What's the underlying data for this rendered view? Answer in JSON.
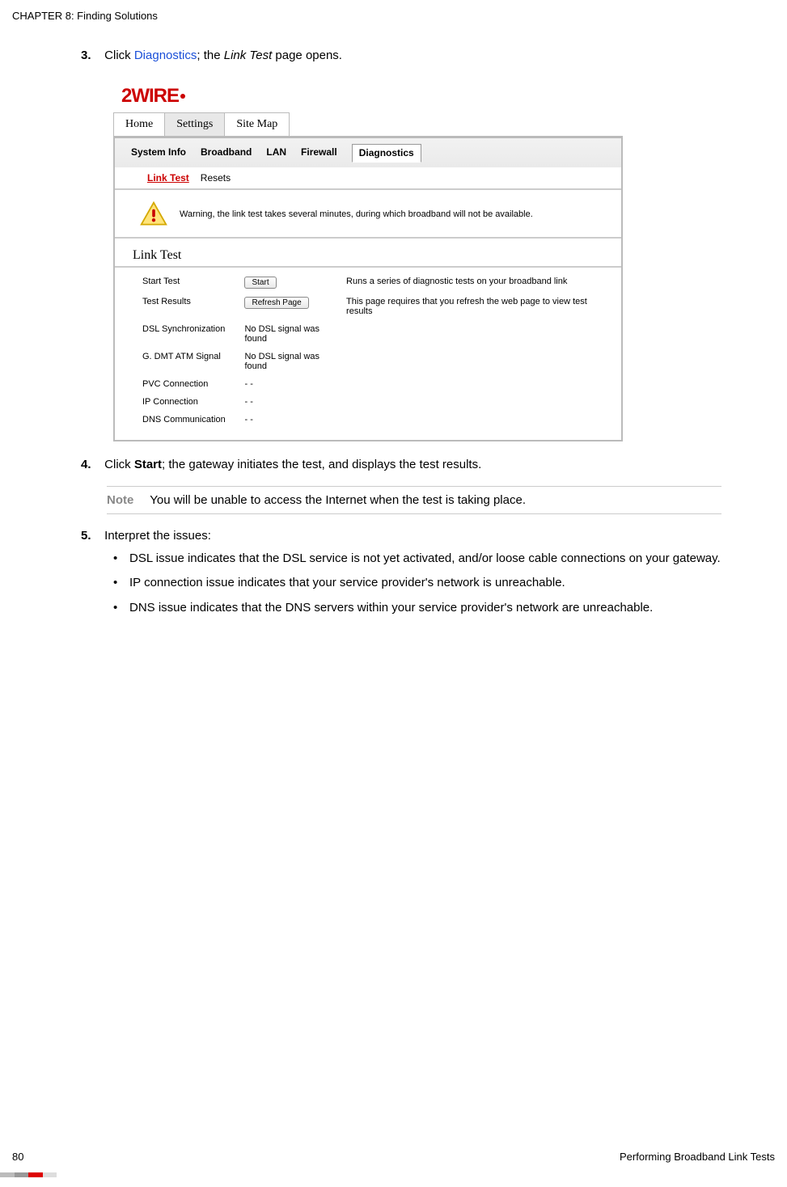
{
  "header": {
    "chapter": "CHAPTER 8: Finding Solutions"
  },
  "steps": {
    "s3": {
      "num": "3.",
      "pre": "Click ",
      "link": "Diagnostics",
      "post_a": "; the ",
      "italic": "Link Test",
      "post_b": " page opens."
    },
    "s4": {
      "num": "4.",
      "pre": "Click ",
      "bold": "Start",
      "post": "; the gateway initiates the test, and displays the test results."
    },
    "s5": {
      "num": "5.",
      "text": "Interpret the issues:",
      "bullets": [
        "DSL issue indicates that the DSL service is not yet activated, and/or loose cable connections on your gateway.",
        "IP connection issue indicates that your service provider's network is unreachable.",
        "DNS issue indicates that the DNS servers within your service provider's network are unreachable."
      ]
    }
  },
  "note": {
    "label": "Note",
    "text": "You will be unable to access the Internet when the test is taking place."
  },
  "shot": {
    "logo": "2WIRE",
    "tabs_top": {
      "home": "Home",
      "settings": "Settings",
      "sitemap": "Site Map"
    },
    "tabs_inner": {
      "sysinfo": "System Info",
      "broadband": "Broadband",
      "lan": "LAN",
      "firewall": "Firewall",
      "diag": "Diagnostics"
    },
    "subtabs": {
      "linktest": "Link Test",
      "resets": "Resets"
    },
    "warning": "Warning, the link test takes several minutes, during which broadband will not be available.",
    "section": "Link Test",
    "rows": {
      "r1": {
        "label": "Start Test",
        "btn": "Start",
        "desc": "Runs a series of diagnostic tests on your broadband link"
      },
      "r2": {
        "label": "Test Results",
        "btn": "Refresh Page",
        "desc": "This page requires that you refresh the web page to view test results"
      },
      "r3": {
        "label": "DSL Synchronization",
        "val": "No DSL signal was found"
      },
      "r4": {
        "label": "G. DMT ATM Signal",
        "val": "No DSL signal was found"
      },
      "r5": {
        "label": "PVC Connection",
        "val": "- -"
      },
      "r6": {
        "label": "IP Connection",
        "val": "- -"
      },
      "r7": {
        "label": "DNS Communication",
        "val": "- -"
      }
    }
  },
  "footer": {
    "page": "80",
    "title": "Performing Broadband Link Tests"
  }
}
